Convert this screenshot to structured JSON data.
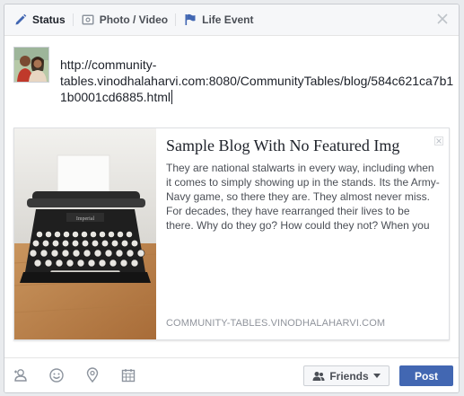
{
  "tabs": [
    {
      "label": "Status",
      "icon": "pencil-icon"
    },
    {
      "label": "Photo / Video",
      "icon": "camera-icon"
    },
    {
      "label": "Life Event",
      "icon": "flag-icon"
    }
  ],
  "composer": {
    "status_text": "http://community-tables.vinodhalaharvi.com:8080/CommunityTables/blog/584c621ca7b11b0001cd6885.html"
  },
  "link_preview": {
    "title": "Sample Blog With No Featured Img",
    "description": "They are national stalwarts in every way, including when it comes to simply showing up in the stands. Its the Army-Navy game, so there they are. They almost never miss. For decades, they have rearranged their lives to be there. Why do they go? How could they not? When you",
    "domain": "COMMUNITY-TABLES.VINODHALAHARVI.COM",
    "image": "typewriter-photo"
  },
  "footer": {
    "audience_label": "Friends",
    "post_label": "Post",
    "icons": [
      "tag-friends-icon",
      "feeling-icon",
      "location-icon",
      "schedule-icon"
    ]
  },
  "colors": {
    "accent": "#4267b2",
    "tab_bar_bg": "#f6f7f9",
    "icon_blue": "#4267b2"
  }
}
